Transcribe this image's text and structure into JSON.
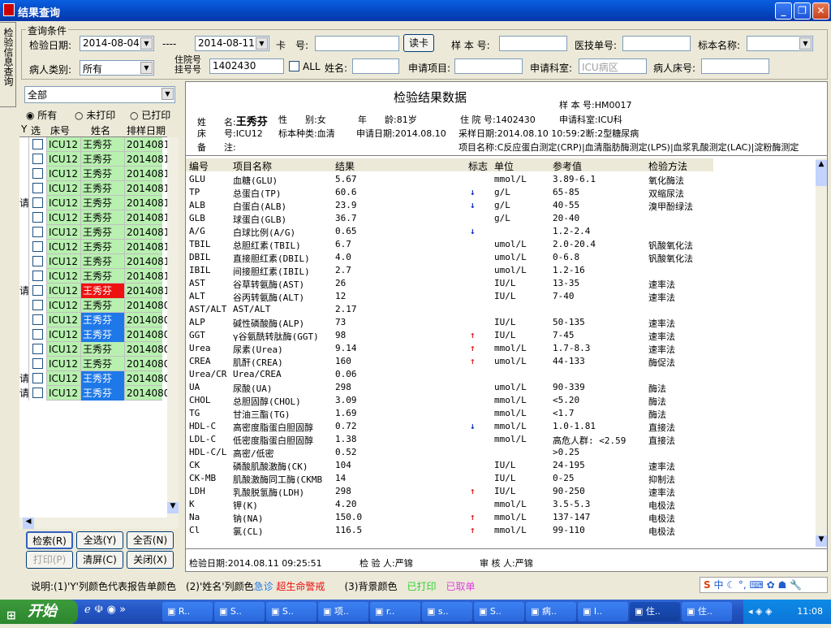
{
  "window": {
    "title": "结果查询",
    "min_icon": "minimize-icon",
    "max_icon": "maximize-icon",
    "close_icon": "close-icon"
  },
  "side_tab": "检验信息查询",
  "query": {
    "group_label": "查询条件",
    "date_label": "检验日期:",
    "date_from": "2014-08-04",
    "dash": "----",
    "date_to": "2014-08-11",
    "card_label": "卡　号:",
    "card_value": "",
    "read_card": "读卡",
    "sample_label": "样 本 号:",
    "sample_value": "",
    "doctor_label": "医技单号:",
    "doctor_value": "",
    "specimen_label": "标本名称:",
    "specimen_value": "",
    "patient_type_label": "病人类别:",
    "patient_type_value": "所有",
    "inpatient_label_1": "住院号",
    "inpatient_label_2": "挂号号",
    "inpatient_value": "1402430",
    "all_label": "ALL",
    "name_label": "姓名:",
    "name_value": "",
    "apply_item_label": "申请项目:",
    "apply_item_value": "",
    "dept_label": "申请科室:",
    "dept_value": "ICU病区",
    "bed_label": "病人床号:",
    "bed_value": ""
  },
  "left": {
    "filter_value": "全部",
    "radio_all": "所有",
    "radio_unprinted": "未打印",
    "radio_printed": "已打印",
    "headers": [
      "Y",
      "选",
      "床号",
      "姓名",
      "排样日期"
    ],
    "rows": [
      {
        "y": "",
        "bed": "ICU12",
        "name": "王秀芬",
        "date": "2014081",
        "bg": "#b8f0b0"
      },
      {
        "y": "",
        "bed": "ICU12",
        "name": "王秀芬",
        "date": "2014081",
        "bg": "#b8f0b0"
      },
      {
        "y": "",
        "bed": "ICU12",
        "name": "王秀芬",
        "date": "2014081",
        "bg": "#b8f0b0"
      },
      {
        "y": "",
        "bed": "ICU12",
        "name": "王秀芬",
        "date": "2014081",
        "bg": "#b8f0b0"
      },
      {
        "y": "请",
        "bed": "ICU12",
        "name": "王秀芬",
        "date": "2014081",
        "bg": "#b8f0b0"
      },
      {
        "y": "",
        "bed": "ICU12",
        "name": "王秀芬",
        "date": "2014081",
        "bg": "#b8f0b0"
      },
      {
        "y": "",
        "bed": "ICU12",
        "name": "王秀芬",
        "date": "2014081",
        "bg": "#b8f0b0"
      },
      {
        "y": "",
        "bed": "ICU12",
        "name": "王秀芬",
        "date": "2014081",
        "bg": "#b8f0b0"
      },
      {
        "y": "",
        "bed": "ICU12",
        "name": "王秀芬",
        "date": "2014081",
        "bg": "#b8f0b0"
      },
      {
        "y": "",
        "bed": "ICU12",
        "name": "王秀芬",
        "date": "2014081",
        "bg": "#b8f0b0"
      },
      {
        "y": "请",
        "bed": "ICU12",
        "name": "王秀芬",
        "date": "2014081",
        "bg": "#b8f0b0",
        "namebg": "#ee1111"
      },
      {
        "y": "",
        "bed": "ICU12",
        "name": "王秀芬",
        "date": "2014080",
        "bg": "#b8f0b0"
      },
      {
        "y": "",
        "bed": "ICU12",
        "name": "王秀芬",
        "date": "2014080",
        "bg": "#b8f0b0",
        "namebg": "#1f78e8"
      },
      {
        "y": "",
        "bed": "ICU12",
        "name": "王秀芬",
        "date": "2014080",
        "bg": "#b8f0b0",
        "namebg": "#1f78e8"
      },
      {
        "y": "",
        "bed": "ICU12",
        "name": "王秀芬",
        "date": "2014080",
        "bg": "#b8f0b0"
      },
      {
        "y": "",
        "bed": "ICU12",
        "name": "王秀芬",
        "date": "2014080",
        "bg": "#b8f0b0"
      },
      {
        "y": "请",
        "bed": "ICU12",
        "name": "王秀芬",
        "date": "2014080",
        "bg": "#b8f0b0",
        "namebg": "#1f78e8"
      },
      {
        "y": "请",
        "bed": "ICU12",
        "name": "王秀芬",
        "date": "2014080",
        "bg": "#b8f0b0",
        "namebg": "#1f78e8"
      }
    ],
    "btn_search": "检索(R)",
    "btn_select_all": "全选(Y)",
    "btn_select_none": "全否(N)",
    "btn_print": "打印(P)",
    "btn_clear": "清屏(C)",
    "btn_close": "关闭(X)"
  },
  "report": {
    "title": "检验结果数据",
    "sample_no_label": "样 本 号:",
    "sample_no": "HM0017",
    "name_label": "姓　　名:",
    "name": "王秀芬",
    "sex_label": "性　　别:",
    "sex": "女",
    "age_label": "年　　龄:",
    "age": "81岁",
    "inpatient_label": "住 院 号:",
    "inpatient": "1402430",
    "dept_label": "申请科室:",
    "dept": "ICU科",
    "bed_label": "床　　号:",
    "bed": "ICU12",
    "specimen_label": "标本种类:",
    "specimen": "血清",
    "apply_date_label": "申请日期:",
    "apply_date": "2014.08.10",
    "collect_label": "采样日期:",
    "collect": "2014.08.10 10:59:2断:2型糖尿病",
    "remark_label": "备　　注:",
    "items_label": "项目名称:",
    "items": "C反应蛋白测定(CRP)|血清脂肪酶测定(LPS)|血浆乳酸测定(LAC)|淀粉酶测定",
    "headers": [
      "编号",
      "项目名称",
      "结果",
      "标志",
      "单位",
      "参考值",
      "检验方法"
    ],
    "rows": [
      {
        "code": "GLU",
        "name": "血糖(GLU)",
        "result": "5.67",
        "flag": "",
        "unit": "mmol/L",
        "ref": "3.89-6.1",
        "method": "氧化酶法"
      },
      {
        "code": "TP",
        "name": "总蛋白(TP)",
        "result": "60.6",
        "flag": "↓",
        "unit": "g/L",
        "ref": "65-85",
        "method": "双缩尿法"
      },
      {
        "code": "ALB",
        "name": "白蛋白(ALB)",
        "result": "23.9",
        "flag": "↓",
        "unit": "g/L",
        "ref": "40-55",
        "method": "溴甲酚绿法"
      },
      {
        "code": "GLB",
        "name": "球蛋白(GLB)",
        "result": "36.7",
        "flag": "",
        "unit": "g/L",
        "ref": "20-40",
        "method": ""
      },
      {
        "code": "A/G",
        "name": "白球比例(A/G)",
        "result": "0.65",
        "flag": "↓",
        "unit": "",
        "ref": "1.2-2.4",
        "method": ""
      },
      {
        "code": "TBIL",
        "name": "总胆红素(TBIL)",
        "result": "6.7",
        "flag": "",
        "unit": "umol/L",
        "ref": "2.0-20.4",
        "method": "钒酸氧化法"
      },
      {
        "code": "DBIL",
        "name": "直接胆红素(DBIL)",
        "result": "4.0",
        "flag": "",
        "unit": "umol/L",
        "ref": "0-6.8",
        "method": "钒酸氧化法"
      },
      {
        "code": "IBIL",
        "name": "间接胆红素(IBIL)",
        "result": "2.7",
        "flag": "",
        "unit": "umol/L",
        "ref": "1.2-16",
        "method": ""
      },
      {
        "code": "AST",
        "name": "谷草转氨酶(AST)",
        "result": "26",
        "flag": "",
        "unit": "IU/L",
        "ref": "13-35",
        "method": "速率法"
      },
      {
        "code": "ALT",
        "name": "谷丙转氨酶(ALT)",
        "result": "12",
        "flag": "",
        "unit": "IU/L",
        "ref": "7-40",
        "method": "速率法"
      },
      {
        "code": "AST/ALT",
        "name": "AST/ALT",
        "result": "2.17",
        "flag": "",
        "unit": "",
        "ref": "",
        "method": ""
      },
      {
        "code": "ALP",
        "name": "碱性磷酸酶(ALP)",
        "result": "73",
        "flag": "",
        "unit": "IU/L",
        "ref": "50-135",
        "method": "速率法"
      },
      {
        "code": "GGT",
        "name": "γ谷氨酰转肽酶(GGT)",
        "result": "98",
        "flag": "↑",
        "unit": "IU/L",
        "ref": "7-45",
        "method": "速率法"
      },
      {
        "code": "Urea",
        "name": "尿素(Urea)",
        "result": "9.14",
        "flag": "↑",
        "unit": "mmol/L",
        "ref": "1.7-8.3",
        "method": "速率法"
      },
      {
        "code": "CREA",
        "name": "肌酐(CREA)",
        "result": "160",
        "flag": "↑",
        "unit": "umol/L",
        "ref": "44-133",
        "method": "酶促法"
      },
      {
        "code": "Urea/CR",
        "name": "Urea/CREA",
        "result": "0.06",
        "flag": "",
        "unit": "",
        "ref": "",
        "method": ""
      },
      {
        "code": "UA",
        "name": "尿酸(UA)",
        "result": "298",
        "flag": "",
        "unit": "umol/L",
        "ref": "90-339",
        "method": "酶法"
      },
      {
        "code": "CHOL",
        "name": "总胆固醇(CHOL)",
        "result": "3.09",
        "flag": "",
        "unit": "mmol/L",
        "ref": "<5.20",
        "method": "酶法"
      },
      {
        "code": "TG",
        "name": "甘油三酯(TG)",
        "result": "1.69",
        "flag": "",
        "unit": "mmol/L",
        "ref": "<1.7",
        "method": "酶法"
      },
      {
        "code": "HDL-C",
        "name": "高密度脂蛋白胆固醇",
        "result": "0.72",
        "flag": "↓",
        "unit": "mmol/L",
        "ref": "1.0-1.81",
        "method": "直接法"
      },
      {
        "code": "LDL-C",
        "name": "低密度脂蛋白胆固醇",
        "result": "1.38",
        "flag": "",
        "unit": "mmol/L",
        "ref": "高危人群: <2.59",
        "method": "直接法"
      },
      {
        "code": "HDL-C/L",
        "name": "高密/低密",
        "result": "0.52",
        "flag": "",
        "unit": "",
        "ref": ">0.25",
        "method": ""
      },
      {
        "code": "CK",
        "name": "磷酸肌酸激酶(CK)",
        "result": "104",
        "flag": "",
        "unit": "IU/L",
        "ref": "24-195",
        "method": "速率法"
      },
      {
        "code": "CK-MB",
        "name": "肌酸激酶同工酶(CKMB",
        "result": "14",
        "flag": "",
        "unit": "IU/L",
        "ref": "0-25",
        "method": "抑制法"
      },
      {
        "code": "LDH",
        "name": "乳酸脱氢酶(LDH)",
        "result": "298",
        "flag": "↑",
        "unit": "IU/L",
        "ref": "90-250",
        "method": "速率法"
      },
      {
        "code": "K",
        "name": "钾(K)",
        "result": "4.20",
        "flag": "",
        "unit": "mmol/L",
        "ref": "3.5-5.3",
        "method": "电极法"
      },
      {
        "code": "Na",
        "name": "钠(NA)",
        "result": "150.0",
        "flag": "↑",
        "unit": "mmol/L",
        "ref": "137-147",
        "method": "电极法"
      },
      {
        "code": "Cl",
        "name": "氯(CL)",
        "result": "116.5",
        "flag": "↑",
        "unit": "mmol/L",
        "ref": "99-110",
        "method": "电极法"
      }
    ],
    "test_date_label": "检验日期:",
    "test_date": "2014.08.11 09:25:51",
    "tester_label": "检 验 人:",
    "tester": "严锦",
    "reviewer_label": "审 核 人:",
    "reviewer": "严锦"
  },
  "legend": {
    "prefix": "说明:(1)'Y'列颜色代表报告单颜色　(2)'姓名'列颜色",
    "urgent": "急诊",
    "critical": "超生命警戒",
    "part3": "(3)背景颜色",
    "printed": "已打印",
    "cancelled": "已取单",
    "colors": {
      "urgent": "#1f78e8",
      "critical": "#ee1111",
      "printed": "#30d030",
      "cancelled": "#e040e0"
    }
  },
  "taskbar": {
    "start": "开始",
    "items": [
      "R..",
      "S..",
      "S..",
      "项..",
      "r..",
      "s..",
      "S..",
      "病..",
      "I..",
      "住..",
      "住.."
    ],
    "clock": "11:08",
    "ime": "中"
  }
}
